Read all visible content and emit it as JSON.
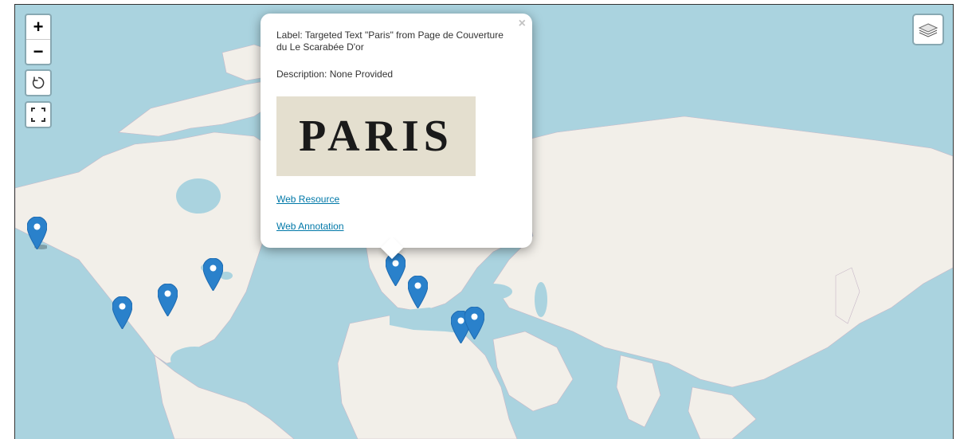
{
  "controls": {
    "zoom_in": "+",
    "zoom_out": "−",
    "reset": "↺",
    "fullscreen": "⛶"
  },
  "layers_icon": "layers-icon",
  "popup": {
    "close": "×",
    "label": "Label: Targeted Text \"Paris\" from Page de Couverture du Le Scarabée D'or",
    "description": "Description: None Provided",
    "image_text": "PARIS",
    "link1": "Web Resource",
    "link2": "Web Annotation"
  },
  "colors": {
    "water": "#aad3df",
    "land": "#f2efe9",
    "marker": "#2a81cb"
  },
  "markers": [
    "alaska",
    "california",
    "colorado",
    "great-lakes",
    "paris",
    "switzerland",
    "crete",
    "israel"
  ]
}
